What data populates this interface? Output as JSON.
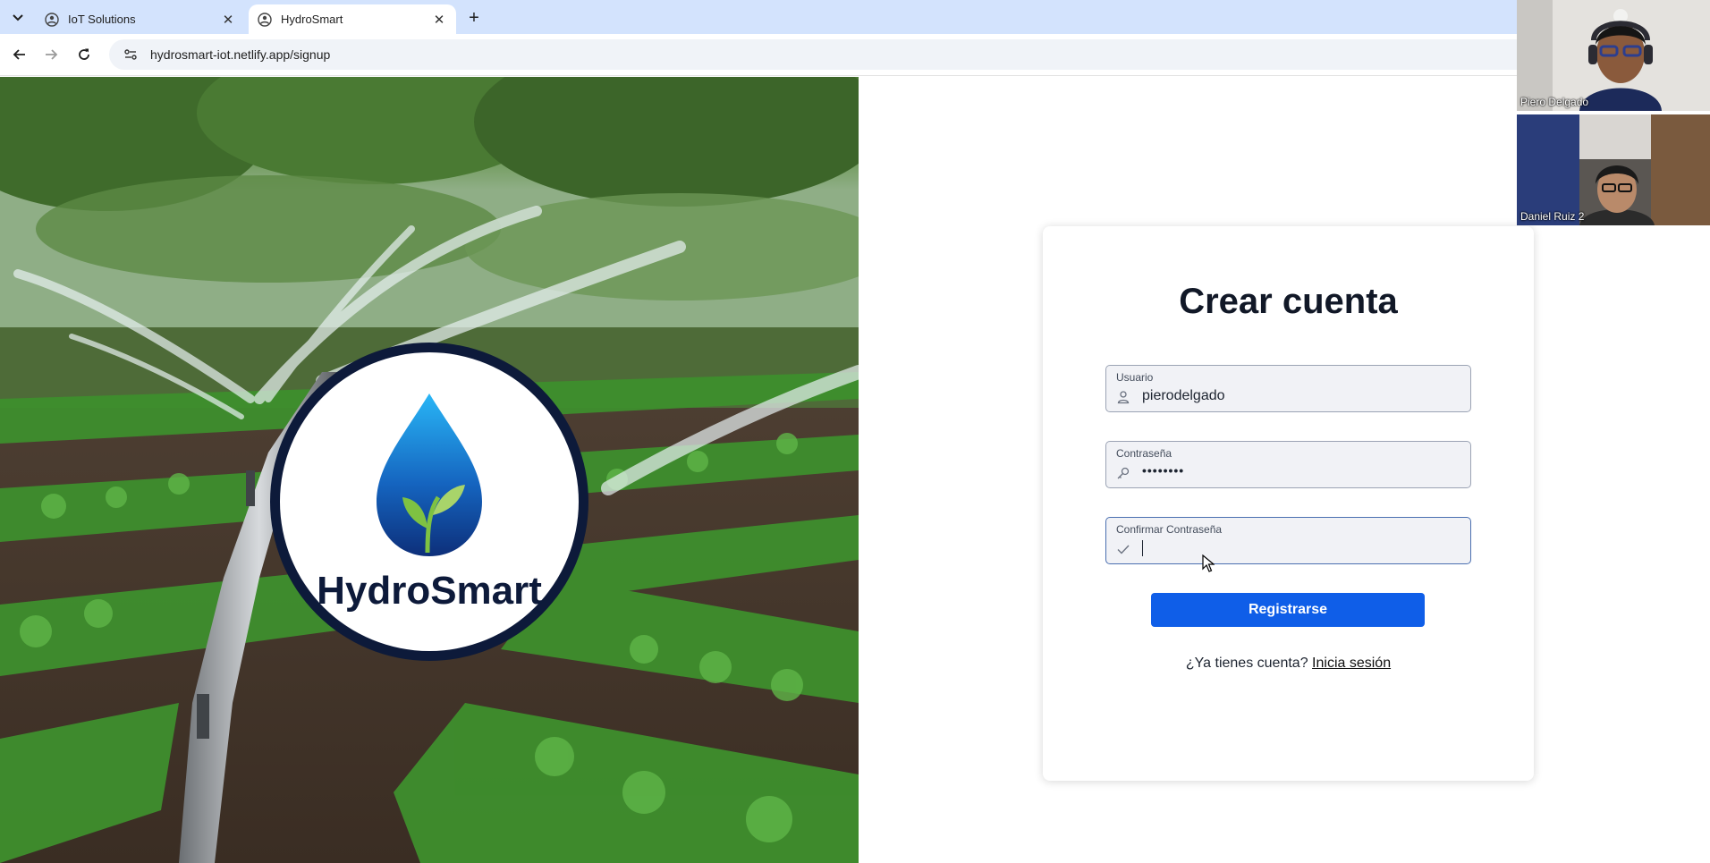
{
  "browser": {
    "tabs": [
      {
        "title": "IoT Solutions",
        "active": false
      },
      {
        "title": "HydroSmart",
        "active": true
      }
    ],
    "url": "hydrosmart-iot.netlify.app/signup"
  },
  "hero": {
    "logo_text": "HydroSmart"
  },
  "form": {
    "title": "Crear cuenta",
    "username": {
      "label": "Usuario",
      "value": "pierodelgado"
    },
    "password": {
      "label": "Contraseña",
      "value": "••••••••"
    },
    "confirm_password": {
      "label": "Confirmar Contraseña",
      "value": ""
    },
    "submit_label": "Registrarse",
    "login_prompt": "¿Ya tienes cuenta?",
    "login_link": "Inicia sesión"
  },
  "video_call": {
    "participants": [
      {
        "name": "Piero Delgado"
      },
      {
        "name": "Daniel Ruiz 2"
      }
    ]
  },
  "colors": {
    "primary_button": "#0f5ee8",
    "tabbar": "#d3e3fd",
    "logo_ring": "#0d1a3a",
    "logo_drop": "#1565c0"
  }
}
